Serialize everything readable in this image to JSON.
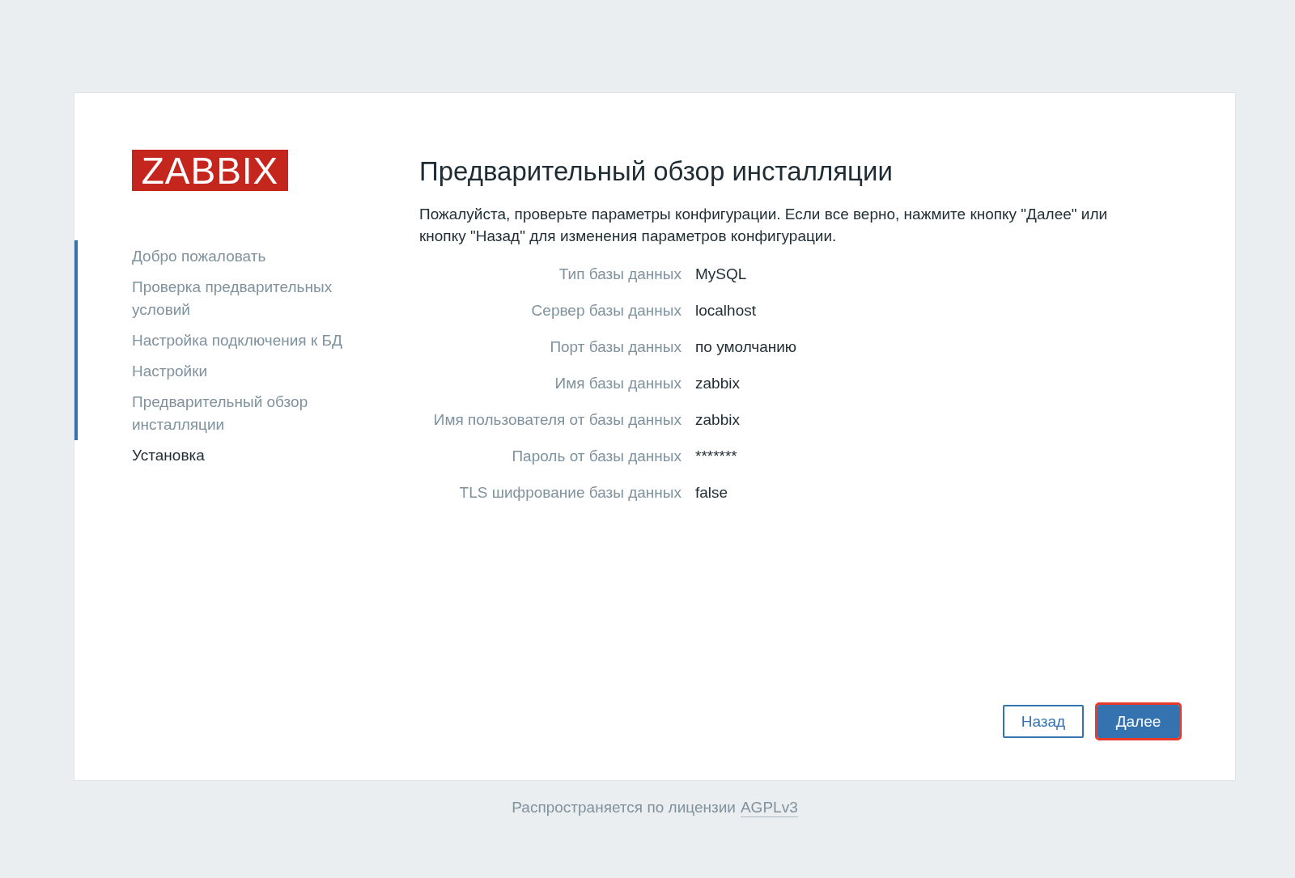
{
  "logo": {
    "text": "ZABBIX"
  },
  "steps": [
    {
      "label": "Добро пожаловать",
      "done": true
    },
    {
      "label": "Проверка предварительных условий",
      "done": true
    },
    {
      "label": "Настройка подключения к БД",
      "done": true
    },
    {
      "label": "Настройки",
      "done": true
    },
    {
      "label": "Предварительный обзор инсталляции",
      "done": true
    },
    {
      "label": "Установка",
      "done": false
    }
  ],
  "title": "Предварительный обзор инсталляции",
  "description": "Пожалуйста, проверьте параметры конфигурации. Если все верно, нажмите кнопку \"Далее\" или кнопку \"Назад\" для изменения параметров конфигурации.",
  "params": [
    {
      "label": "Тип базы данных",
      "value": "MySQL"
    },
    {
      "label": "Сервер базы данных",
      "value": "localhost"
    },
    {
      "label": "Порт базы данных",
      "value": "по умолчанию"
    },
    {
      "label": "Имя базы данных",
      "value": "zabbix"
    },
    {
      "label": "Имя пользователя от базы данных",
      "value": "zabbix"
    },
    {
      "label": "Пароль от базы данных",
      "value": "*******"
    },
    {
      "label": "TLS шифрование базы данных",
      "value": "false"
    }
  ],
  "buttons": [
    {
      "label": "Назад",
      "kind": "secondary",
      "highlighted": false
    },
    {
      "label": "Далее",
      "kind": "primary",
      "highlighted": true
    }
  ],
  "footer": {
    "text": "Распространяется по лицензии",
    "link": "AGPLv3"
  }
}
